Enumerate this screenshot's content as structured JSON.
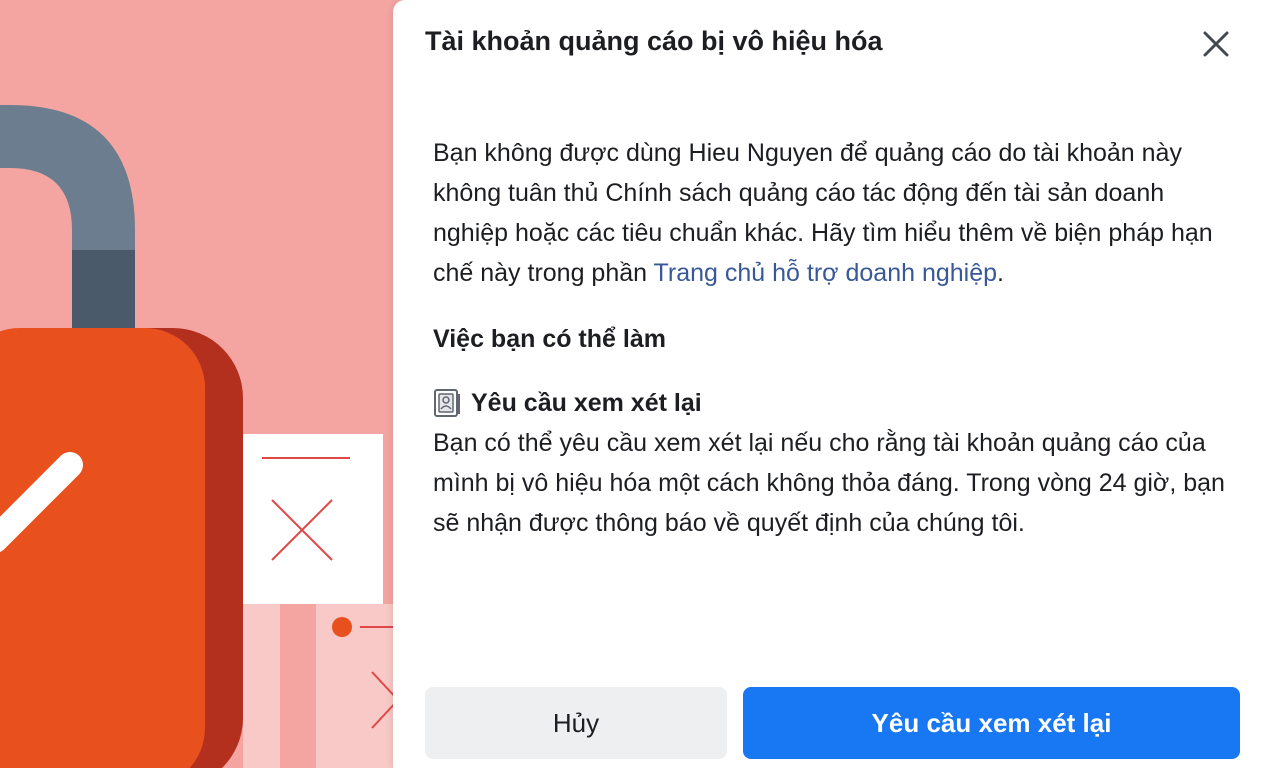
{
  "dialog": {
    "title": "Tài khoản quảng cáo bị vô hiệu hóa",
    "close_icon": "close-icon",
    "body_text_before_link": "Bạn không được dùng Hieu Nguyen để quảng cáo do tài khoản này không tuân thủ Chính sách quảng cáo tác động đến tài sản doanh nghiệp hoặc các tiêu chuẩn khác. Hãy tìm hiểu thêm về biện pháp hạn chế này trong phần ",
    "body_link_text": "Trang chủ hỗ trợ doanh nghiệp",
    "body_text_after_link": ".",
    "section_heading": "Việc bạn có thể làm",
    "option": {
      "icon": "id-card-icon",
      "title": "Yêu cầu xem xét lại",
      "description": "Bạn có thể yêu cầu xem xét lại nếu cho rằng tài khoản quảng cáo của mình bị vô hiệu hóa một cách không thỏa đáng. Trong vòng 24 giờ, bạn sẽ nhận được thông báo về quyết định của chúng tôi."
    },
    "buttons": {
      "cancel_label": "Hủy",
      "primary_label": "Yêu cầu xem xét lại"
    }
  },
  "colors": {
    "background_pink": "#f4a5a1",
    "primary_blue": "#1877f2",
    "link_blue": "#385898",
    "lock_orange": "#e8501e",
    "lock_shackle": "#6b7d8e"
  },
  "illustration": {
    "icon": "padlock-illustration"
  }
}
